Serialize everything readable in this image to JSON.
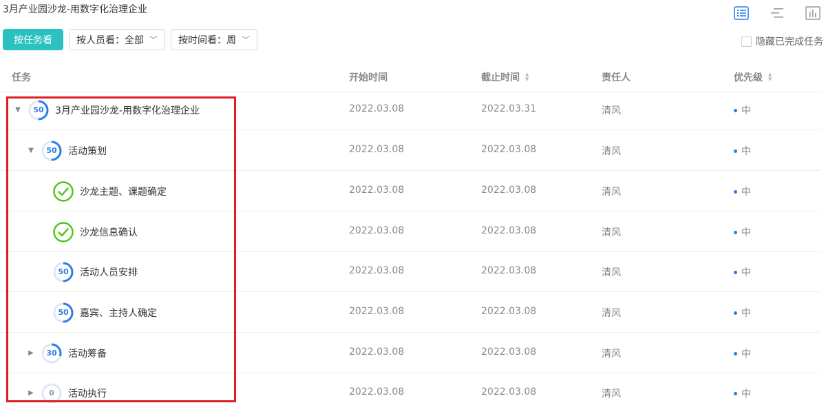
{
  "project_title": "3月产业园沙龙-用数字化治理企业",
  "toolbar": {
    "by_task_label": "按任务看",
    "by_person_label": "按人员看：全部",
    "by_time_label": "按时间看：周"
  },
  "hide_completed_label": "隐藏已完成任务",
  "view_icons": [
    "list-view-icon",
    "gantt-view-icon",
    "chart-view-icon"
  ],
  "columns": {
    "task": "任务",
    "start": "开始时间",
    "end": "截止时间",
    "owner": "责任人",
    "priority": "优先级"
  },
  "colors": {
    "accent": "#2cc1c1",
    "progress": "#2b7de9",
    "done": "#52c41a",
    "highlight": "#e01b24"
  },
  "rows": [
    {
      "name": "3月产业园沙龙-用数字化治理企业",
      "progress": "50",
      "start": "2022.03.08",
      "end": "2022.03.31",
      "owner": "清风",
      "priority": "中"
    },
    {
      "name": "活动策划",
      "progress": "50",
      "start": "2022.03.08",
      "end": "2022.03.08",
      "owner": "清风",
      "priority": "中"
    },
    {
      "name": "沙龙主题、课题确定",
      "progress": "done",
      "start": "2022.03.08",
      "end": "2022.03.08",
      "owner": "清风",
      "priority": "中"
    },
    {
      "name": "沙龙信息确认",
      "progress": "done",
      "start": "2022.03.08",
      "end": "2022.03.08",
      "owner": "清风",
      "priority": "中"
    },
    {
      "name": "活动人员安排",
      "progress": "50",
      "start": "2022.03.08",
      "end": "2022.03.08",
      "owner": "清风",
      "priority": "中"
    },
    {
      "name": "嘉宾、主持人确定",
      "progress": "50",
      "start": "2022.03.08",
      "end": "2022.03.08",
      "owner": "清风",
      "priority": "中"
    },
    {
      "name": "活动筹备",
      "progress": "30",
      "start": "2022.03.08",
      "end": "2022.03.08",
      "owner": "清风",
      "priority": "中"
    },
    {
      "name": "活动执行",
      "progress": "0",
      "start": "2022.03.08",
      "end": "2022.03.08",
      "owner": "清风",
      "priority": "中"
    }
  ]
}
